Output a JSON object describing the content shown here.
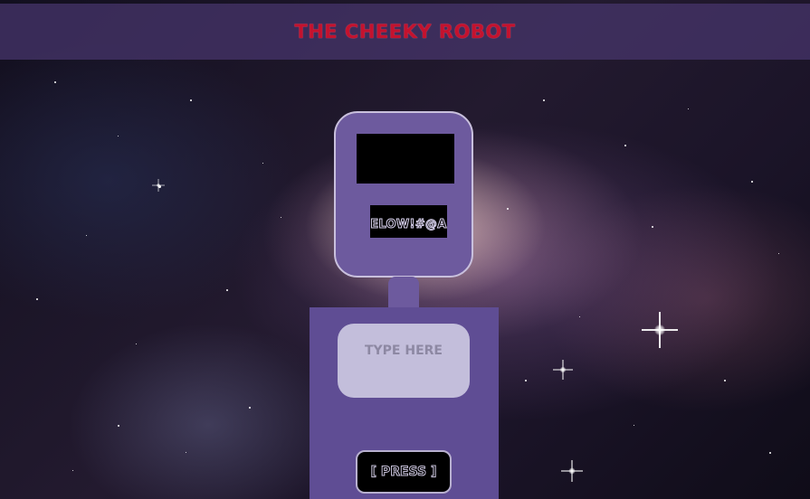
{
  "header": {
    "title": "THE CHEEKY ROBOT"
  },
  "robot": {
    "mouth_text": "BELOW!#@AS",
    "input": {
      "placeholder": "TYPE HERE",
      "value": ""
    },
    "press_label": "[ PRESS ]"
  },
  "colors": {
    "title": "#c4122e",
    "header_bar": "#48366e",
    "robot_head": "#6d5a9e",
    "robot_body": "#5f4d94",
    "input_background": "#c3bedb",
    "screen": "#000000"
  }
}
